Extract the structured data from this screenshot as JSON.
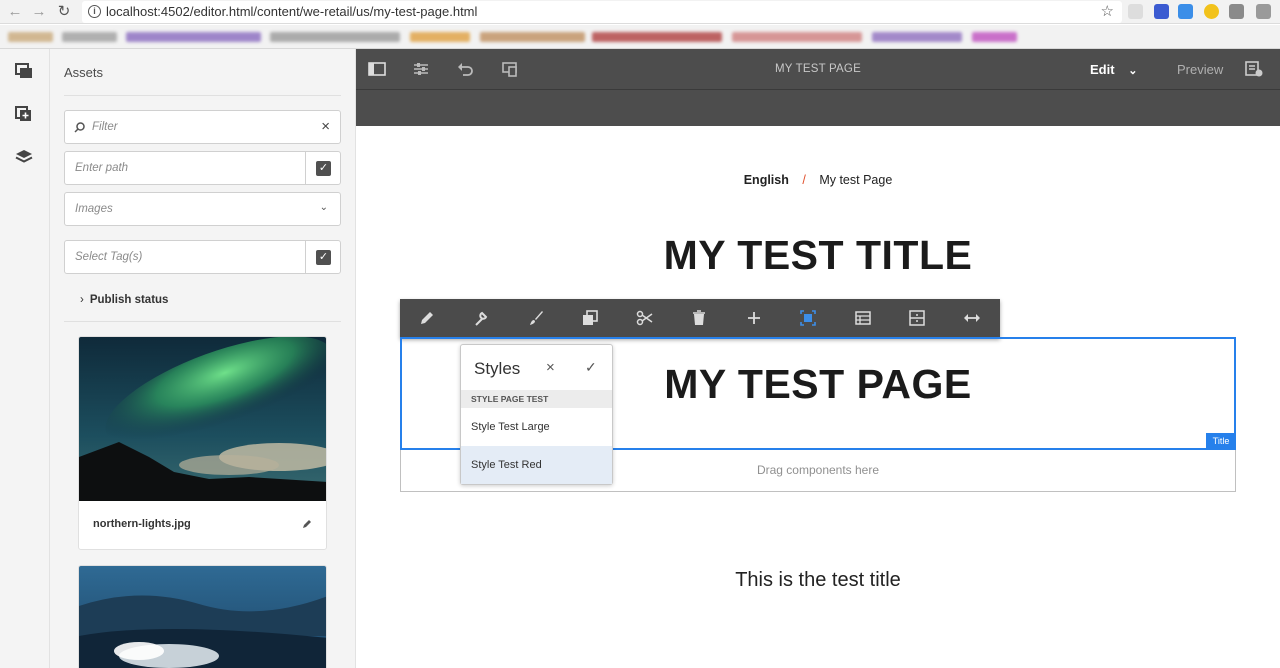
{
  "browser": {
    "url": "localhost:4502/editor.html/content/we-retail/us/my-test-page.html",
    "back_icon": "arrow-left-icon",
    "forward_icon": "arrow-right-icon",
    "reload_icon": "reload-icon",
    "star_icon": "star-icon"
  },
  "rail": {
    "items": [
      {
        "icon": "assets-icon"
      },
      {
        "icon": "components-icon"
      },
      {
        "icon": "layers-icon"
      }
    ]
  },
  "assets": {
    "title": "Assets",
    "filter_placeholder": "Filter",
    "path_placeholder": "Enter path",
    "type_value": "Images",
    "tags_placeholder": "Select Tag(s)",
    "publish_status": "Publish status",
    "cards": [
      {
        "name": "northern-lights.jpg"
      },
      {
        "name": ""
      }
    ]
  },
  "editor": {
    "page_title": "MY TEST PAGE",
    "mode": "Edit",
    "preview": "Preview",
    "colors": {
      "accent": "#2680eb",
      "toolbar": "#4d4d4d"
    }
  },
  "page": {
    "breadcrumb_first": "English",
    "breadcrumb_sep": "/",
    "breadcrumb_current": "My test Page",
    "heading1": "MY TEST TITLE",
    "heading2": "MY TEST PAGE",
    "component_label": "Title",
    "drop_text": "Drag components here",
    "test_title": "This is the test title"
  },
  "styles_popover": {
    "title": "Styles",
    "group": "STYLE PAGE TEST",
    "options": [
      "Style Test Large",
      "Style Test Red"
    ]
  }
}
